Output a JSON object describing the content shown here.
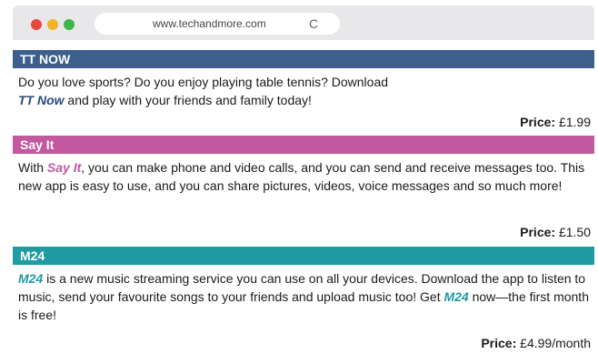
{
  "browser": {
    "url": "www.techandmore.com",
    "reload_icon": "reload-icon"
  },
  "apps": [
    {
      "title": "TT NOW",
      "brand": "TT Now",
      "text_before": "Do you love sports? Do you enjoy playing table tennis? Download",
      "text_after": " and play with your friends and family today!",
      "price_label": "Price:",
      "price_value": "£1.99"
    },
    {
      "title": "Say It",
      "brand": "Say It",
      "text_before": "With ",
      "text_after": ",  you can make phone and video calls, and you can send and receive messages too. This new app is easy to use, and you can share pictures, videos, voice messages and so much more!",
      "price_label": "Price:",
      "price_value": "£1.50"
    },
    {
      "title": "M24",
      "brand": "M24",
      "text_before": "",
      "text_mid": " is a new music streaming service you can use on all your devices. Download the app to listen to music, send your favourite songs to your friends and upload music too! Get ",
      "text_after": " now—the first month is free!",
      "price_label": "Price:",
      "price_value": "£4.99/month"
    }
  ],
  "colors": {
    "tt": "#3c5f8c",
    "say": "#c2589d",
    "m24": "#1f9ba2"
  }
}
